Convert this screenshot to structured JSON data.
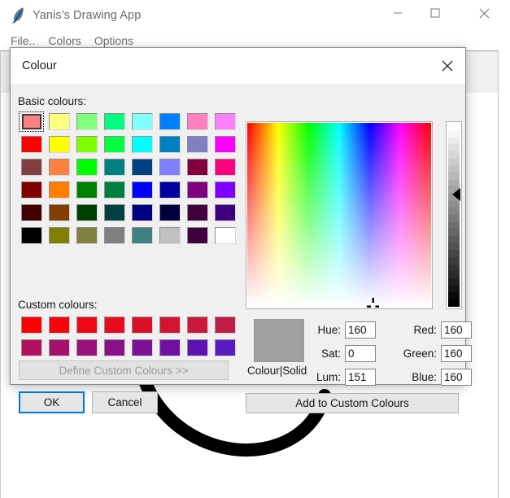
{
  "app": {
    "title": "Yanis's Drawing App",
    "icon": "quill-feather-icon",
    "window_controls": {
      "minimize": "minimize-icon",
      "maximize": "maximize-icon",
      "close": "close-icon"
    },
    "menu": [
      {
        "label": "File.."
      },
      {
        "label": "Colors"
      },
      {
        "label": "Options"
      }
    ]
  },
  "dialog": {
    "title": "Colour",
    "close_icon": "close-icon",
    "basic_colours_label": "Basic colours:",
    "custom_colours_label": "Custom colours:",
    "define_custom_label": "Define Custom Colours >>",
    "add_to_custom_label": "Add to Custom Colours",
    "ok_label": "OK",
    "cancel_label": "Cancel",
    "preview_label": "Colour|Solid",
    "preview_color": "#a0a0a0",
    "selected_basic_index": 0,
    "basic_colours": [
      "#FF8080",
      "#FFFF80",
      "#80FF80",
      "#00FF80",
      "#80FFFF",
      "#0080FF",
      "#FF80C0",
      "#FF80FF",
      "#FF0000",
      "#FFFF00",
      "#80FF00",
      "#00FF40",
      "#00FFFF",
      "#0080C0",
      "#8080C0",
      "#FF00FF",
      "#804040",
      "#FF8040",
      "#00FF00",
      "#008080",
      "#004080",
      "#8080FF",
      "#800040",
      "#FF0080",
      "#800000",
      "#FF8000",
      "#008000",
      "#008040",
      "#0000FF",
      "#0000A0",
      "#800080",
      "#8000FF",
      "#400000",
      "#804000",
      "#004000",
      "#004040",
      "#000080",
      "#000040",
      "#400040",
      "#400080",
      "#000000",
      "#808000",
      "#808040",
      "#808080",
      "#408080",
      "#C0C0C0",
      "#400040",
      "#FFFFFF"
    ],
    "custom_colours": [
      "#FF0000",
      "#F60409",
      "#ED0813",
      "#E40C1D",
      "#DB1027",
      "#D21431",
      "#C9183B",
      "#C01C45",
      "#B5105E",
      "#A6116C",
      "#98117A",
      "#8A1188",
      "#7C1196",
      "#6E11A4",
      "#6011B2",
      "#5A1CC0"
    ],
    "fields": {
      "hue": {
        "label": "Hue:",
        "value": "160"
      },
      "sat": {
        "label": "Sat:",
        "value": "0"
      },
      "lum": {
        "label": "Lum:",
        "value": "151"
      },
      "red": {
        "label": "Red:",
        "value": "160"
      },
      "green": {
        "label": "Green:",
        "value": "160"
      },
      "blue": {
        "label": "Blue:",
        "value": "160"
      }
    }
  }
}
